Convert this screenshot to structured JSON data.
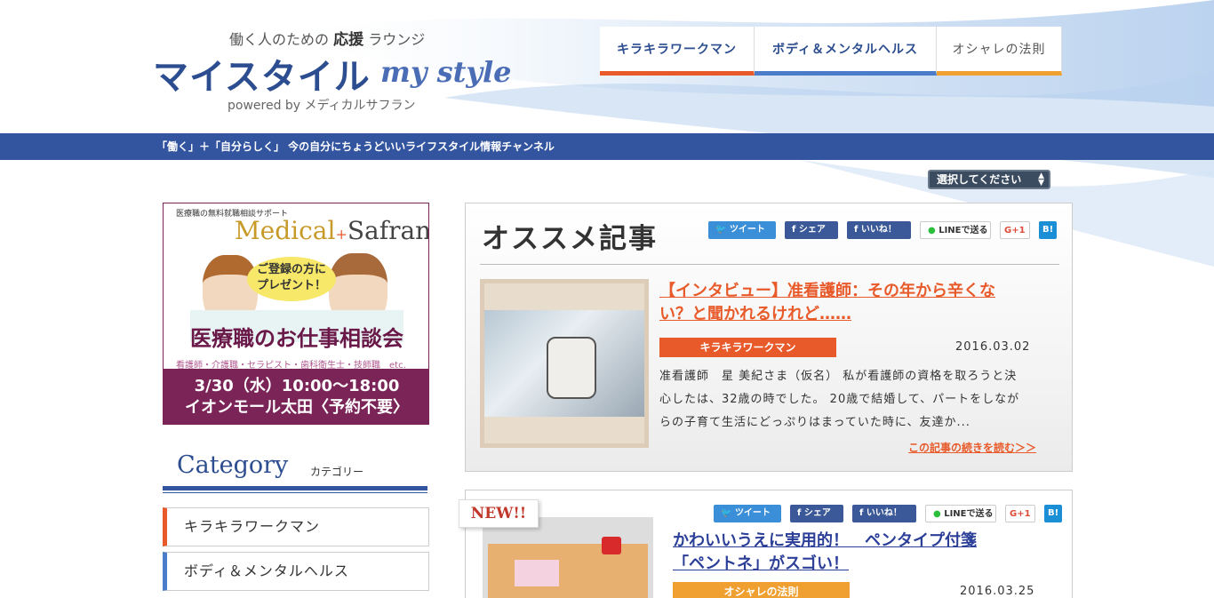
{
  "header": {
    "tagline_pre": "働く人のための",
    "tagline_strong": "応援",
    "tagline_post": "ラウンジ",
    "logo_ja": "マイスタイル",
    "logo_en": "my style",
    "powered": "powered by メディカルサフラン"
  },
  "nav": [
    {
      "label": "キラキラワークマン"
    },
    {
      "label": "ボディ＆メンタルヘルス"
    },
    {
      "label": "オシャレの法則"
    }
  ],
  "bar_text": "「働く」＋「自分らしく」 今の自分にちょうどいいライフスタイル情報チャンネル",
  "select_label": "選択してください",
  "banner": {
    "small": "医療職の無料就職相談サポート",
    "logo_a": "Medical",
    "logo_plus": "+",
    "logo_b": "Safran",
    "bubble_1": "ご登録の方に",
    "bubble_2": "プレゼント！",
    "title": "医療職のお仕事相談会",
    "sub": "看護師・介護職・セラピスト・歯科衛生士・技師職　etc.",
    "date": "3/30（水）10:00〜18:00",
    "place": "イオンモール太田〈予約不要〉"
  },
  "category": {
    "title_en": "Category",
    "title_ja": "カテゴリー",
    "items": [
      {
        "label": "キラキラワークマン"
      },
      {
        "label": "ボディ＆メンタルヘルス"
      }
    ]
  },
  "share": {
    "tweet": "ツイート",
    "share": "シェア",
    "like": "いいね！",
    "line": "LINEで送る",
    "gplus": "G+1",
    "hatena": "B!"
  },
  "featured": {
    "heading": "オススメ記事",
    "title_1": "【インタビュー】准看護師：その年から辛くな",
    "title_2": "い？と聞かれるけれど……",
    "tag": "キラキラワークマン",
    "date": "2016.03.02",
    "body_1": "准看護師　星 美紀さま（仮名） 私が看護師の資格を取ろうと決",
    "body_2": "心したは、32歳の時でした。 20歳で結婚して、パートをしなが",
    "body_3": "らの子育て生活にどっぷりはまっていた時に、友達か...",
    "more": "この記事の続きを読む＞＞"
  },
  "article2": {
    "badge": "NEW!!",
    "title_1": "かわいいうえに実用的！　ペンタイプ付箋",
    "title_2": "「ペントネ」がスゴい！",
    "tag": "オシャレの法則",
    "date": "2016.03.25"
  },
  "colors": {
    "brand_blue": "#3355a0",
    "accent_orange": "#e85a2a",
    "accent_yellow": "#f0a030",
    "banner_purple": "#7a2458"
  }
}
